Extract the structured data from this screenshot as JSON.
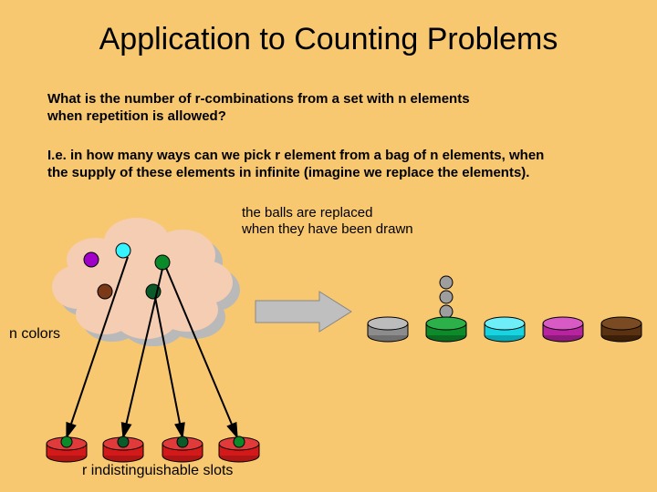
{
  "title": "Application to Counting Problems",
  "q1_line1": "What is the number of r-combinations from a set with n elements",
  "q1_line2": " when repetition is allowed?",
  "q2_line1": "I.e. in how many ways can we pick r element from a bag of n elements, when",
  "q2_line2": "the supply of these elements in infinite (imagine we replace the elements).",
  "caption_line1": "the balls are replaced",
  "caption_line2": "when they have been drawn",
  "n_colors_label": "n colors",
  "slots_label": "r indistinguishable slots"
}
